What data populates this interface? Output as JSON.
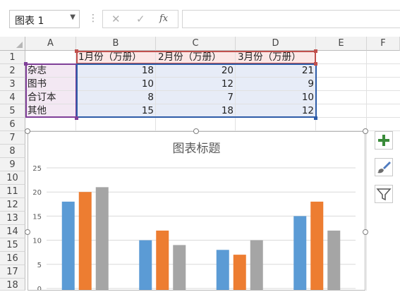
{
  "formula_bar": {
    "name_box": "图表 1",
    "cancel_glyph": "✕",
    "enter_glyph": "✓",
    "fx_label": "fx",
    "formula": ""
  },
  "columns": [
    "A",
    "B",
    "C",
    "D",
    "E",
    "F"
  ],
  "rows": [
    "1",
    "2",
    "3",
    "4",
    "5",
    "6",
    "7",
    "8",
    "9",
    "10",
    "11",
    "12",
    "13",
    "14",
    "15",
    "16",
    "17",
    "18"
  ],
  "sheet": {
    "headers": [
      "1月份（万册）",
      "2月份（万册）",
      "3月份（万册）"
    ],
    "rows": [
      {
        "label": "杂志",
        "values": [
          "18",
          "20",
          "21"
        ]
      },
      {
        "label": "图书",
        "values": [
          "10",
          "12",
          "9"
        ]
      },
      {
        "label": "合订本",
        "values": [
          "8",
          "7",
          "10"
        ]
      },
      {
        "label": "其他",
        "values": [
          "15",
          "18",
          "12"
        ]
      }
    ]
  },
  "chart_data": {
    "type": "bar",
    "title": "图表标题",
    "categories": [
      "杂志",
      "图书",
      "合订本",
      "其他"
    ],
    "series": [
      {
        "name": "1月份（万册）",
        "values": [
          18,
          10,
          8,
          15
        ],
        "color": "#5b9bd5"
      },
      {
        "name": "2月份（万册）",
        "values": [
          20,
          12,
          7,
          18
        ],
        "color": "#ed7d31"
      },
      {
        "name": "3月份（万册）",
        "values": [
          21,
          9,
          10,
          12
        ],
        "color": "#a5a5a5"
      }
    ],
    "ylim": [
      0,
      25
    ],
    "yticks": [
      "0",
      "5",
      "10",
      "15",
      "20",
      "25"
    ],
    "grid": true
  },
  "chart_tools": {
    "add_elements_icon": "plus-icon",
    "styles_icon": "paintbrush-icon",
    "filter_icon": "funnel-icon"
  },
  "colors": {
    "header_range": "#c0504d",
    "category_range": "#7f3f98",
    "data_range": "#2e5ca8",
    "accent_green": "#3a8b3a"
  }
}
